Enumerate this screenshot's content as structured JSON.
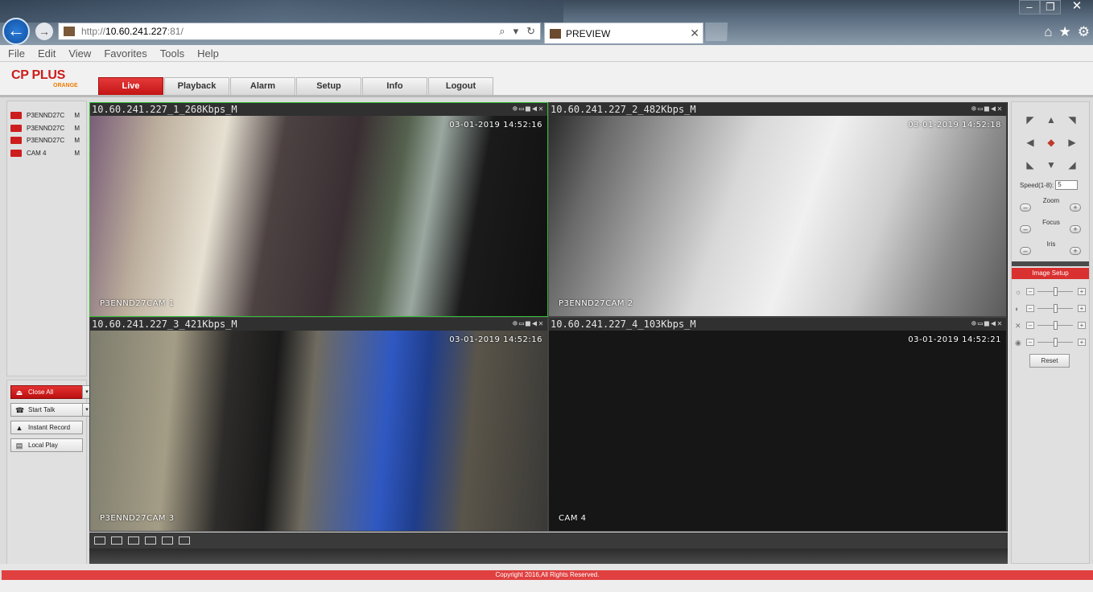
{
  "browser": {
    "url_prefix": "http://",
    "url_host": "10.60.241.227",
    "url_suffix": ":81/",
    "tab_title": "PREVIEW",
    "menu": [
      "File",
      "Edit",
      "View",
      "Favorites",
      "Tools",
      "Help"
    ]
  },
  "app": {
    "logo_text": "CP PLUS",
    "logo_sub": "ORANGE",
    "nav": [
      "Live",
      "Playback",
      "Alarm",
      "Setup",
      "Info",
      "Logout"
    ],
    "active_nav": "Live"
  },
  "channels": [
    {
      "name": "P3ENND27C",
      "mode": "M"
    },
    {
      "name": "P3ENND27C",
      "mode": "M"
    },
    {
      "name": "P3ENND27C",
      "mode": "M"
    },
    {
      "name": "CAM 4",
      "mode": "M"
    }
  ],
  "controls": {
    "close_all": "Close All",
    "start_talk": "Start Talk",
    "instant_record": "Instant Record",
    "local_play": "Local Play"
  },
  "panes": [
    {
      "stream": "10.60.241.227_1_268Kbps_M",
      "timestamp": "03-01-2019 14:52:16",
      "cam": "P3ENND27CAM 1"
    },
    {
      "stream": "10.60.241.227_2_482Kbps_M",
      "timestamp": "03-01-2019 14:52:18",
      "cam": "P3ENND27CAM 2"
    },
    {
      "stream": "10.60.241.227_3_421Kbps_M",
      "timestamp": "03-01-2019 14:52:16",
      "cam": "P3ENND27CAM 3"
    },
    {
      "stream": "10.60.241.227_4_103Kbps_M",
      "timestamp": "03-01-2019 14:52:21",
      "cam": "CAM 4"
    }
  ],
  "ptz": {
    "speed_label": "Speed(1-8):",
    "speed_value": "5",
    "zoom": "Zoom",
    "focus": "Focus",
    "iris": "Iris",
    "image_setup": "Image Setup",
    "reset": "Reset"
  },
  "footer": "Copyright 2016,All Rights Reserved."
}
